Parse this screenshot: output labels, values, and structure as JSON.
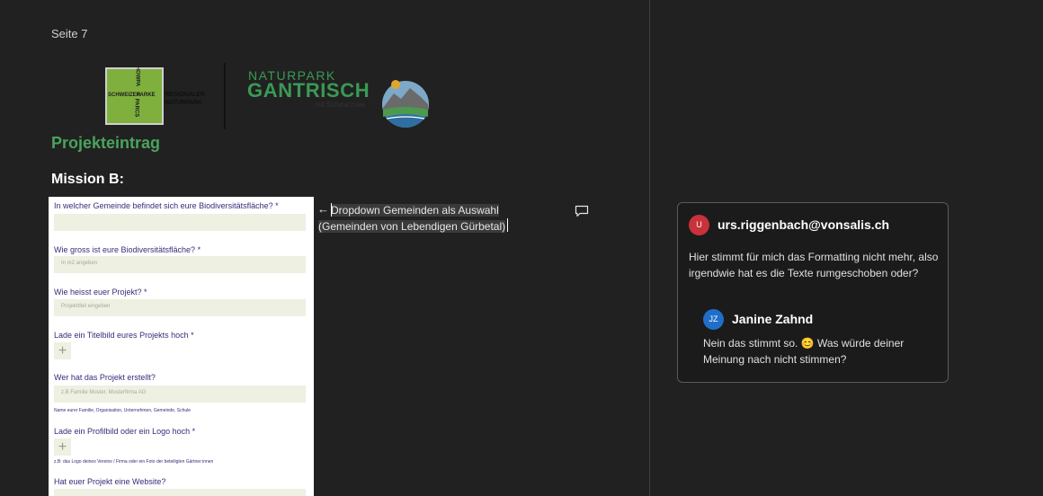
{
  "document": {
    "page_label": "Seite 7",
    "logos": {
      "parks_cells": [
        "SCHWEIZER",
        "PARKE",
        "PARCS",
        "HOWPA"
      ],
      "parks_right_line1": "REGIONALER",
      "parks_right_line2": "NATURPARK",
      "gantrisch_top": "NATURPARK",
      "gantrisch_main": "GANTRISCH",
      "gantrisch_sub": "mit Schwarzsee"
    },
    "heading_project": "Projekteintrag",
    "heading_mission": "Mission B:",
    "form": {
      "q1_label": "In welcher Gemeinde befindet sich eure Biodiversitätsfläche? *",
      "q2_label": "Wie gross ist eure Biodiversitätsfläche? *",
      "q2_placeholder": "In m2 angeben",
      "q3_label": "Wie heisst euer Projekt? *",
      "q3_placeholder": "Projekttitel eingeben",
      "q4_label": "Lade ein Titelbild eures Projekts hoch *",
      "q5_label": "Wer hat das Projekt erstellt?",
      "q5_placeholder": "z.B Familie Muster, Musterfirma AG",
      "q5_hint": "Name eurer Familie, Organisation, Unternehmen, Gemeinde, Schule",
      "q6_label": "Lade ein Profilbild oder ein Logo hoch *",
      "q6_hint": "z.B: das Logo deines Vereins / Firma oder ein Foto der beteiligten Gärtner:innen",
      "q7_label": "Hat euer Projekt eine Website?",
      "plus_glyph": "+"
    },
    "inline_note": {
      "arrow": "←",
      "line1": "Dropdown Gemeinden als Auswahl",
      "line2": "(Gemeinden von Lebendigen Gürbetal)"
    }
  },
  "comment_thread": {
    "author1": {
      "initial": "U",
      "name": "urs.riggenbach@vonsalis.ch",
      "color": "#c8323a",
      "text": "Hier stimmt für mich das Formatting nicht mehr, also irgendwie hat es die Texte rumgeschoben oder?"
    },
    "author2": {
      "initial": "JZ",
      "name": "Janine Zahnd",
      "color": "#1f6fc9",
      "text": "Nein das stimmt so. 😊 Was würde deiner Meinung nach nicht stimmen?"
    }
  }
}
